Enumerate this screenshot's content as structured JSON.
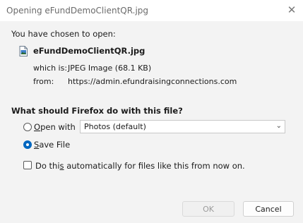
{
  "window": {
    "title": "Opening eFundDemoClientQR.jpg"
  },
  "intro": "You have chosen to open:",
  "file": {
    "name": "eFundDemoClientQR.jpg",
    "icon": "image-file-icon",
    "which_is_label": "which is:",
    "which_is_value": "JPEG Image (68.1 KB)",
    "from_label": "from:",
    "from_value": "https://admin.efundraisingconnections.com"
  },
  "question": "What should Firefox do with this file?",
  "options": {
    "open_with": {
      "prefix": "",
      "mnemonic": "O",
      "rest": "pen with",
      "selected": false
    },
    "app_select": {
      "value": "Photos (default)"
    },
    "save_file": {
      "prefix": "",
      "mnemonic": "S",
      "rest": "ave File",
      "selected": true
    }
  },
  "auto": {
    "prefix": "Do thi",
    "mnemonic": "s",
    "rest": " automatically for files like this from now on.",
    "checked": false
  },
  "buttons": {
    "ok": "OK",
    "cancel": "Cancel"
  },
  "colors": {
    "accent": "#0067c0"
  }
}
